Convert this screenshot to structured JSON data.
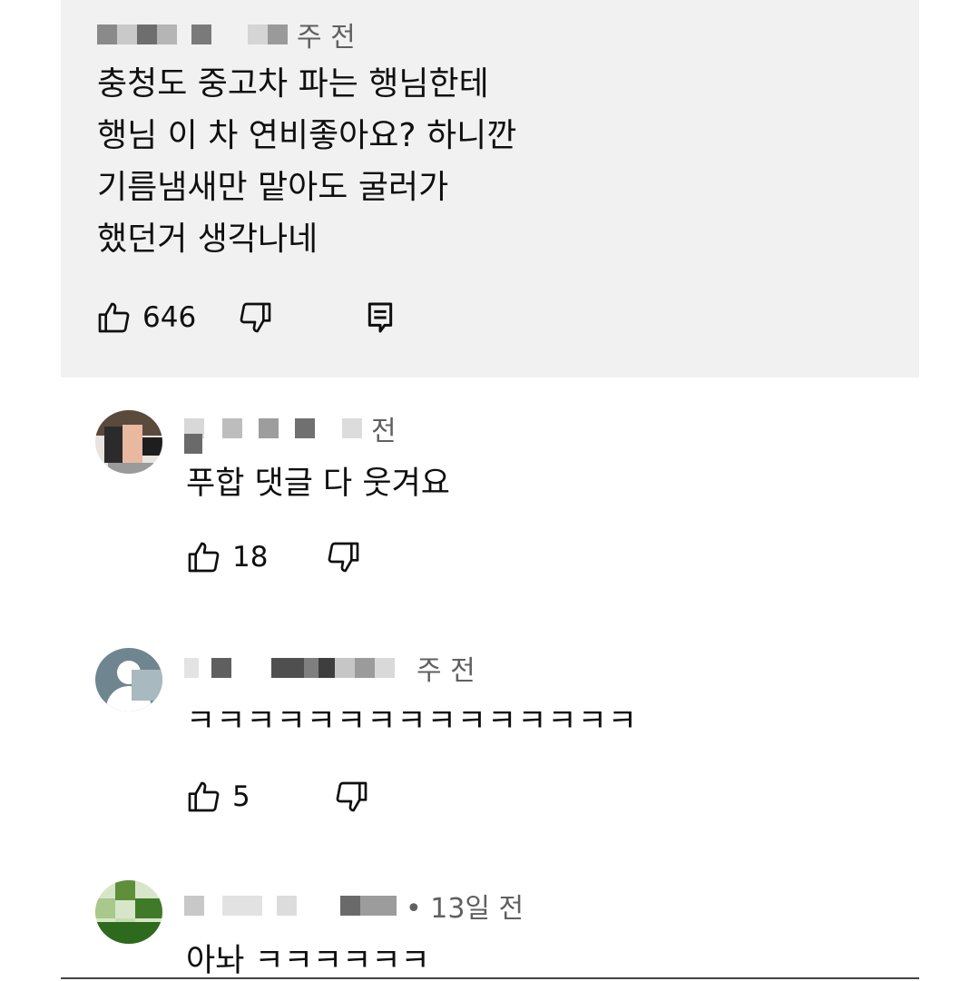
{
  "top_comment": {
    "time": "주 전",
    "lines": [
      "충청도 중고차 파는 행님한테",
      "행님 이 차 연비좋아요? 하니깐",
      "기름냄새만 맡아도 굴러가",
      "했던거 생각나네"
    ],
    "like_count": "646",
    "icons": {
      "like": "thumbs-up-icon",
      "dislike": "thumbs-down-icon",
      "reply": "reply-icon"
    }
  },
  "replies": [
    {
      "time": "전",
      "text": "푸합 댓글 다 웃겨요",
      "like_count": "18"
    },
    {
      "time": "주 전",
      "text": "ㅋㅋㅋㅋㅋㅋㅋㅋㅋㅋㅋㅋㅋㅋㅋ",
      "like_count": "5"
    },
    {
      "time": "• 13일 전",
      "text": "아놔 ㅋㅋㅋㅋㅋㅋ"
    }
  ],
  "colors": {
    "highlight_bg": "#f1f1f1",
    "meta_text": "#606060",
    "body_text": "#0f0f0f"
  }
}
